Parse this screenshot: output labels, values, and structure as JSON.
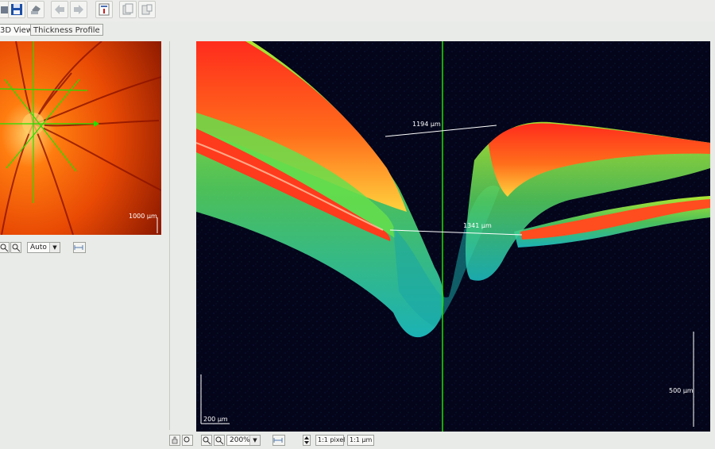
{
  "tabs": [
    "3D View",
    "Thickness Profile"
  ],
  "fundus": {
    "scale_label": "1000 µm"
  },
  "left_controls": {
    "zoom_mode": "Auto"
  },
  "oct": {
    "measurements": [
      "1194 µm",
      "1341 µm"
    ],
    "scale_bar_horizontal": "200 µm",
    "scale_bar_vertical": "500 µm"
  },
  "bottom_controls": {
    "zoom_value": "200%",
    "pixel_ratio": "1:1 pixel",
    "micron_ratio": "1:1 µm"
  },
  "colors": {
    "oct_background": "#04051a",
    "marker_green": "#22e000",
    "fundus_orange": "#ff6b00"
  },
  "icons": [
    "save-icon",
    "print-icon",
    "back-arrow-icon",
    "forward-arrow-icon",
    "report-icon",
    "copy-icon",
    "zoom-in-icon",
    "zoom-out-icon",
    "pan-icon",
    "scroll-icon"
  ]
}
